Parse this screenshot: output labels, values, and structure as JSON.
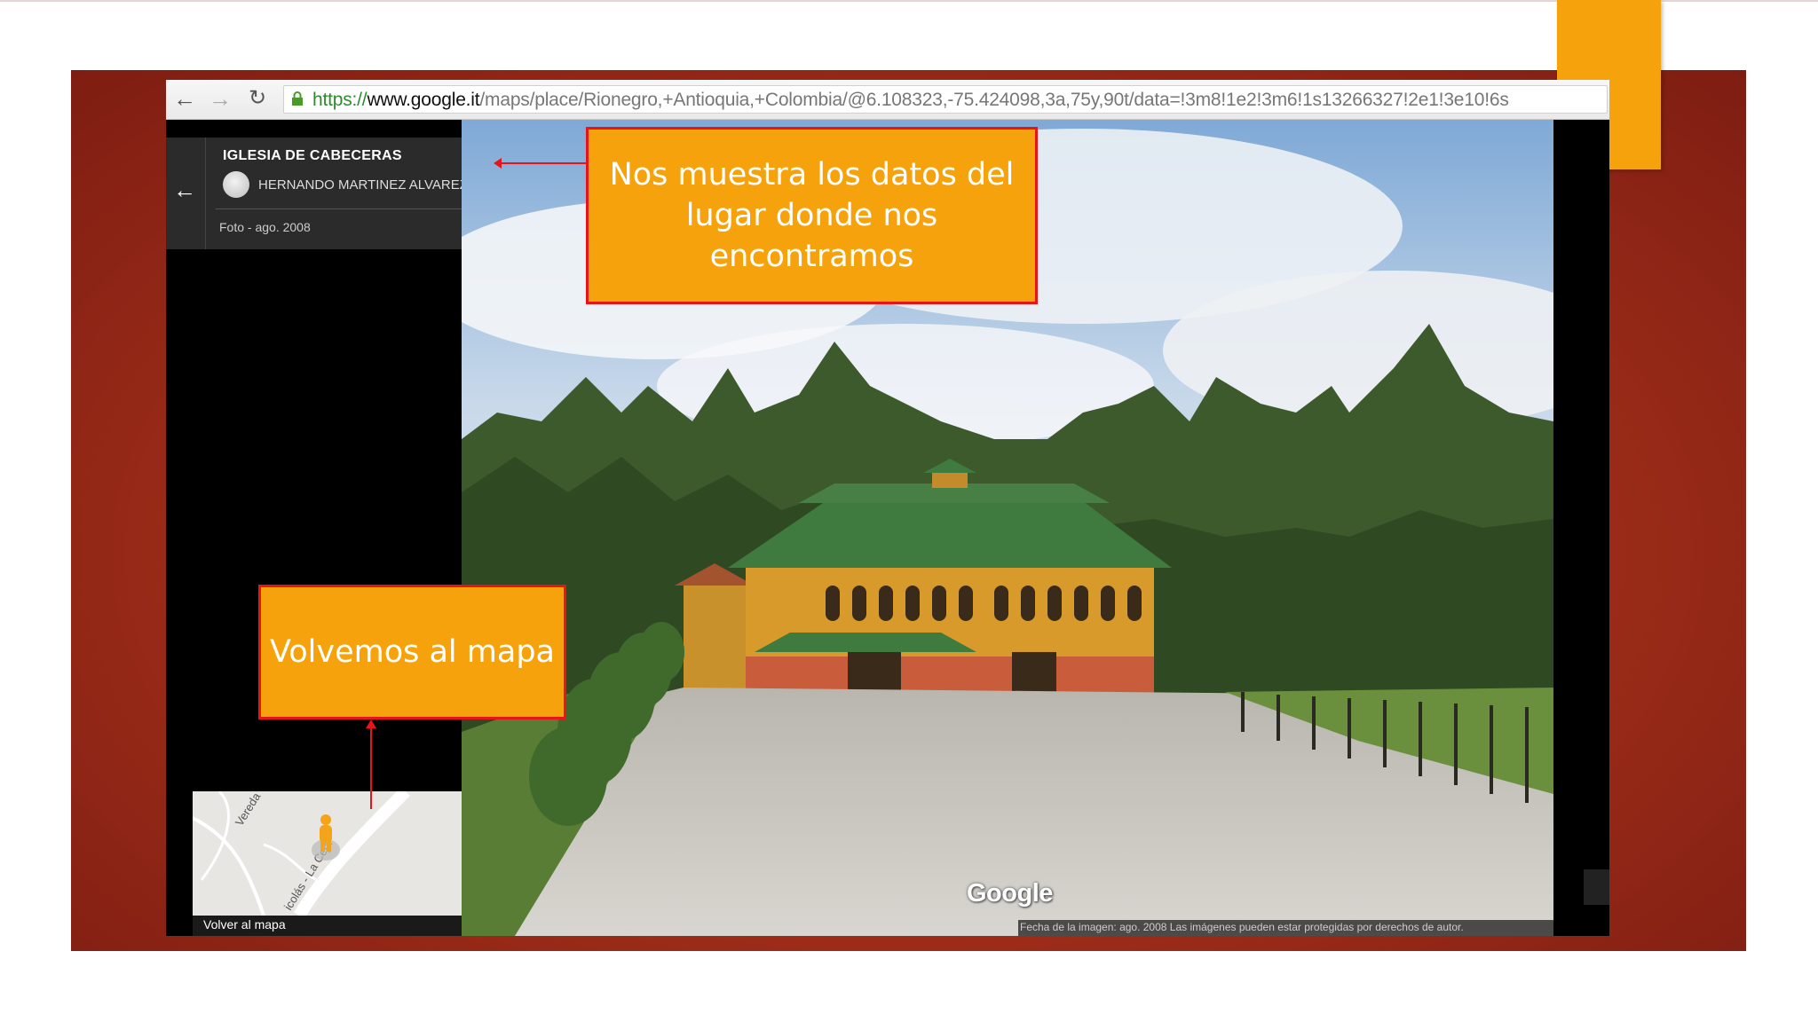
{
  "browser": {
    "url_scheme": "https://",
    "url_host": "www.google.it",
    "url_path": "/maps/place/Rionegro,+Antioquia,+Colombia/@6.108323,-75.424098,3a,75y,90t/data=!3m8!1e2!3m6!1s13266327!2e1!3e10!6s"
  },
  "place_card": {
    "title": "IGLESIA DE CABECERAS",
    "author": "HERNANDO MARTINEZ ALVAREZ",
    "photo_date": "Foto - ago. 2008"
  },
  "minimap": {
    "label": "Volver al mapa",
    "road_labels": [
      "Vereda",
      "icolás - La Ceja"
    ]
  },
  "viewer": {
    "google_logo": "Google",
    "footer": "Fecha de la imagen: ago. 2008     Las imágenes pueden estar protegidas por derechos de autor."
  },
  "callouts": {
    "top_text": "Nos muestra los datos del lugar donde nos encontramos",
    "bottom_text": "Volvemos al mapa"
  },
  "colors": {
    "callout_fill": "#f5a20d",
    "callout_border": "#e8141a",
    "slide_background": "#a4301a"
  }
}
